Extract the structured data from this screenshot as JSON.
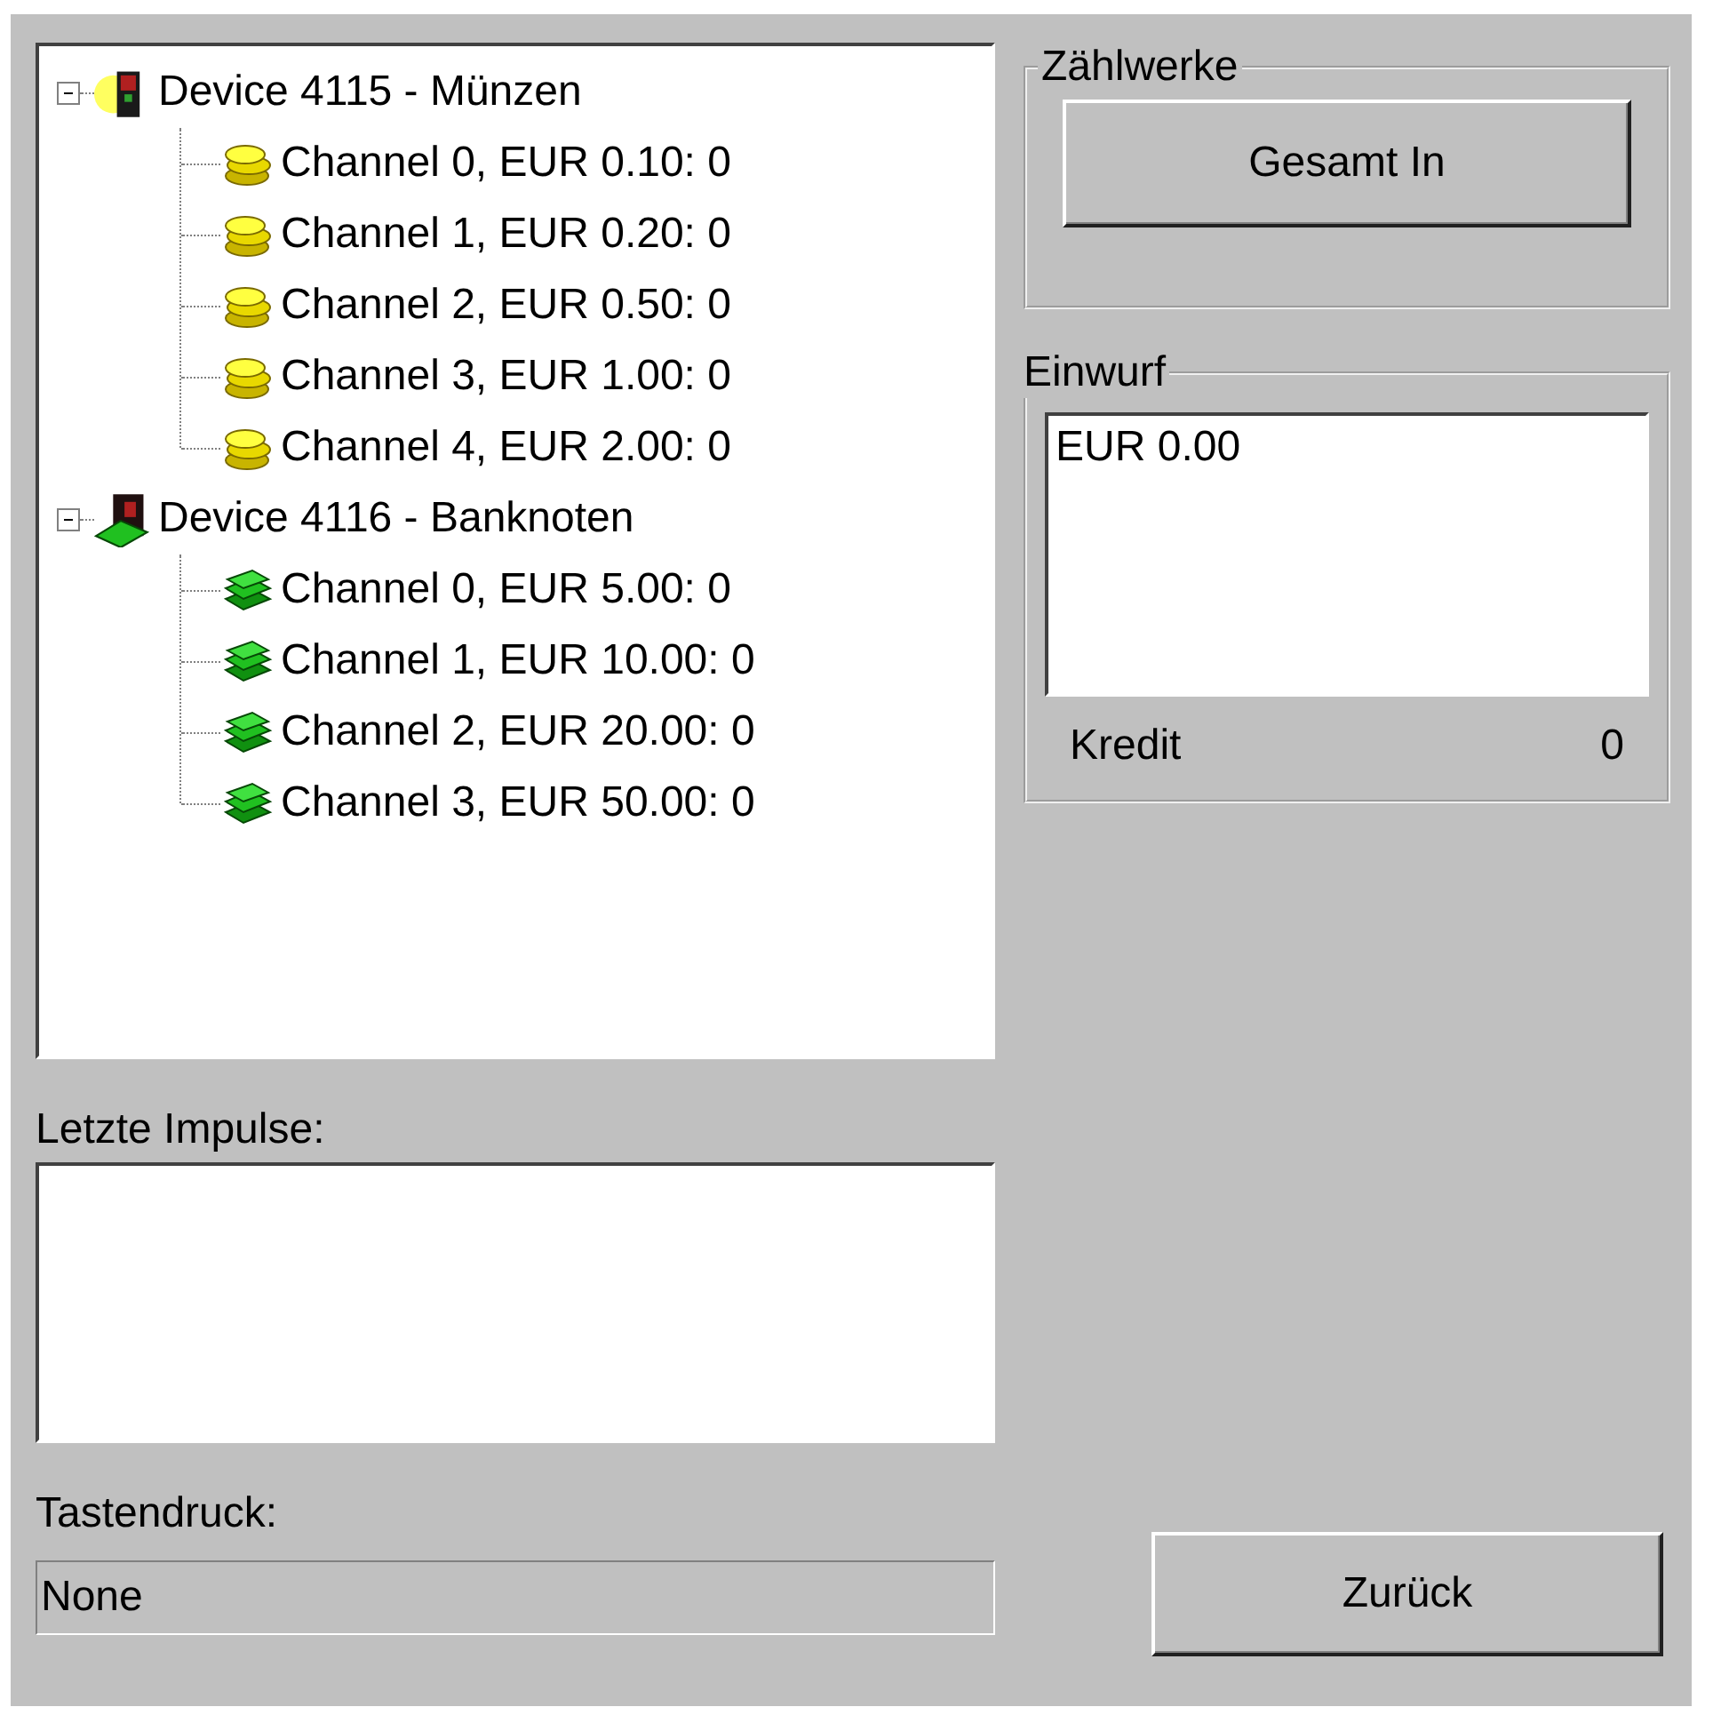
{
  "tree": [
    {
      "kind": "coin_device",
      "label": "Device 4115 - Münzen",
      "expanded": true,
      "children": [
        {
          "kind": "coin",
          "label": "Channel 0, EUR 0.10: 0"
        },
        {
          "kind": "coin",
          "label": "Channel 1, EUR 0.20: 0"
        },
        {
          "kind": "coin",
          "label": "Channel 2, EUR 0.50: 0"
        },
        {
          "kind": "coin",
          "label": "Channel 3, EUR 1.00: 0"
        },
        {
          "kind": "coin",
          "label": "Channel 4, EUR 2.00: 0"
        }
      ]
    },
    {
      "kind": "note_device",
      "label": "Device 4116 - Banknoten",
      "expanded": true,
      "children": [
        {
          "kind": "note",
          "label": "Channel 0, EUR 5.00: 0"
        },
        {
          "kind": "note",
          "label": "Channel 1, EUR 10.00: 0"
        },
        {
          "kind": "note",
          "label": "Channel 2, EUR 20.00: 0"
        },
        {
          "kind": "note",
          "label": "Channel 3, EUR 50.00: 0"
        }
      ]
    }
  ],
  "impulses": {
    "label": "Letzte Impulse:"
  },
  "keypress": {
    "label": "Tastendruck:",
    "value": "None"
  },
  "counters": {
    "title": "Zählwerke",
    "button": "Gesamt In"
  },
  "insert": {
    "title": "Einwurf",
    "lines": [
      "EUR 0.00"
    ],
    "credit_label": "Kredit",
    "credit_value": "0"
  },
  "back_button": "Zurück"
}
